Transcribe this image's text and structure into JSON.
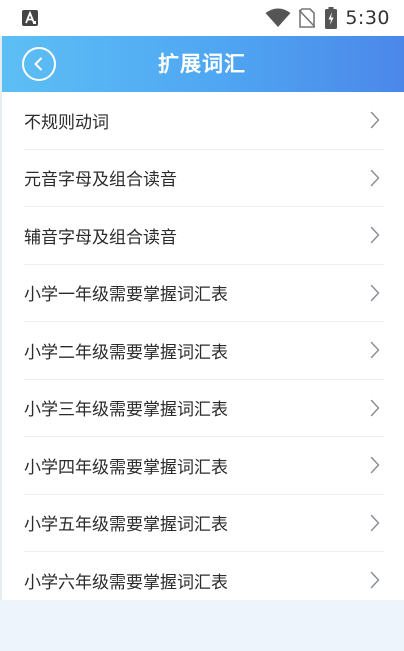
{
  "status_bar": {
    "time": "5:30",
    "left_icon": "a-notification-icon",
    "icons": [
      "wifi-icon",
      "no-sim-icon",
      "battery-charging-icon"
    ]
  },
  "header": {
    "title": "扩展词汇",
    "back_icon": "chevron-left-icon",
    "gradient_start": "#5dbff5",
    "gradient_end": "#4b87e9"
  },
  "list": {
    "items": [
      {
        "label": "不规则动词"
      },
      {
        "label": "元音字母及组合读音"
      },
      {
        "label": "辅音字母及组合读音"
      },
      {
        "label": "小学一年级需要掌握词汇表"
      },
      {
        "label": "小学二年级需要掌握词汇表"
      },
      {
        "label": "小学三年级需要掌握词汇表"
      },
      {
        "label": "小学四年级需要掌握词汇表"
      },
      {
        "label": "小学五年级需要掌握词汇表"
      },
      {
        "label": "小学六年级需要掌握词汇表"
      }
    ]
  }
}
